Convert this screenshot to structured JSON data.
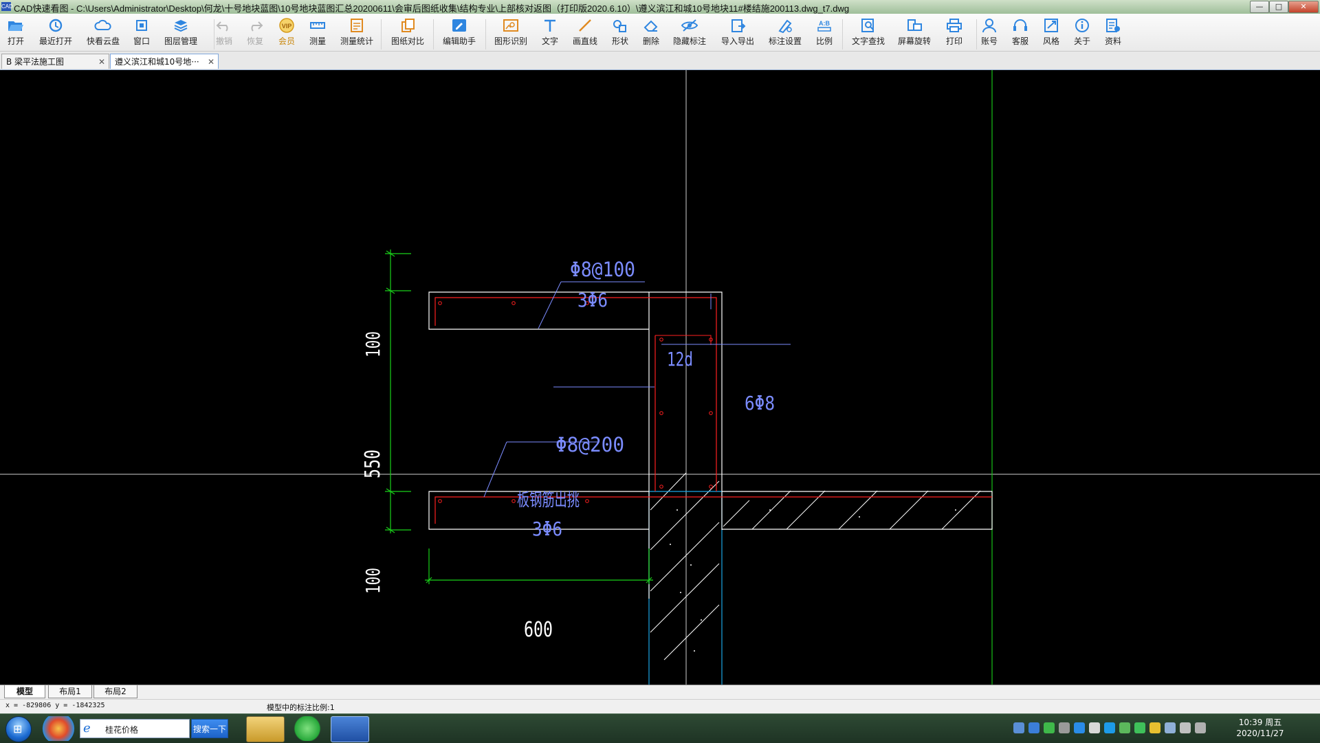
{
  "window": {
    "title": "CAD快速看图 - C:\\Users\\Administrator\\Desktop\\何龙\\十号地块蓝图\\10号地块蓝图汇总20200611\\会审后图纸收集\\结构专业\\上部核对返图（打印版2020.6.10）\\遵义滨江和城10号地块11#楼结施200113.dwg_t7.dwg",
    "app_icon_text": "CAD",
    "minimize": "—",
    "maximize": "□",
    "close": "✕"
  },
  "toolbar": {
    "items": [
      {
        "label": "打开",
        "icon": "folder-open-icon"
      },
      {
        "label": "最近打开",
        "icon": "history-icon"
      },
      {
        "label": "快看云盘",
        "icon": "cloud-icon"
      },
      {
        "label": "窗口",
        "icon": "window-icon"
      },
      {
        "label": "图层管理",
        "icon": "layers-icon"
      },
      {
        "label": "撤销",
        "icon": "undo-icon",
        "disabled": true
      },
      {
        "label": "恢复",
        "icon": "redo-icon",
        "disabled": true
      },
      {
        "label": "会员",
        "icon": "vip-icon",
        "vip": true
      },
      {
        "label": "测量",
        "icon": "ruler-icon"
      },
      {
        "label": "测量统计",
        "icon": "measure-stats-icon"
      },
      {
        "label": "图纸对比",
        "icon": "compare-icon"
      },
      {
        "label": "编辑助手",
        "icon": "edit-assistant-icon"
      },
      {
        "label": "图形识别",
        "icon": "shape-recognize-icon"
      },
      {
        "label": "文字",
        "icon": "text-icon"
      },
      {
        "label": "画直线",
        "icon": "line-icon"
      },
      {
        "label": "形状",
        "icon": "shape-icon"
      },
      {
        "label": "删除",
        "icon": "eraser-icon"
      },
      {
        "label": "隐藏标注",
        "icon": "hide-annotation-icon"
      },
      {
        "label": "导入导出",
        "icon": "import-export-icon"
      },
      {
        "label": "标注设置",
        "icon": "annotation-settings-icon"
      },
      {
        "label": "比例",
        "icon": "scale-icon"
      },
      {
        "label": "文字查找",
        "icon": "text-search-icon"
      },
      {
        "label": "屏幕旋转",
        "icon": "rotate-screen-icon"
      },
      {
        "label": "打印",
        "icon": "print-icon"
      },
      {
        "label": "账号",
        "icon": "account-icon"
      },
      {
        "label": "客服",
        "icon": "headset-icon"
      },
      {
        "label": "风格",
        "icon": "style-icon"
      },
      {
        "label": "关于",
        "icon": "info-icon"
      },
      {
        "label": "资料",
        "icon": "documents-icon"
      }
    ]
  },
  "tabs": [
    {
      "label": "B 梁平法施工图",
      "close": "✕"
    },
    {
      "label": "遵义滨江和城10号地···",
      "close": "✕",
      "active": true
    }
  ],
  "drawing": {
    "labels": {
      "top_rebar": "Φ8@100",
      "top_rebar_2": "3Φ6",
      "wall_anchor": "12d",
      "wall_rebar": "6Φ8",
      "stirrup": "Φ8@200",
      "slab_note": "板钢筋出挑",
      "slab_rebar": "3Φ6",
      "dim_top": "100",
      "dim_mid": "550",
      "dim_bottom": "100",
      "dim_width": "600"
    },
    "colors": {
      "outline": "#ffffff",
      "rebar": "#ff2020",
      "annotation": "#7b8cff",
      "dimension": "#19d219",
      "wall_edge": "#1aa7e6",
      "crosshair": "#d0d0d0",
      "green_line": "#18c018",
      "hatch": "#ffffff"
    }
  },
  "layout_tabs": [
    {
      "label": "模型",
      "active": true
    },
    {
      "label": "布局1"
    },
    {
      "label": "布局2"
    }
  ],
  "status": {
    "coords": "x = -829806  y = -1842325",
    "scale_text": "模型中的标注比例:1"
  },
  "taskbar": {
    "search_text": "桂花价格",
    "search_button": "搜索一下",
    "time": "10:39 周五",
    "date": "2020/11/27"
  }
}
